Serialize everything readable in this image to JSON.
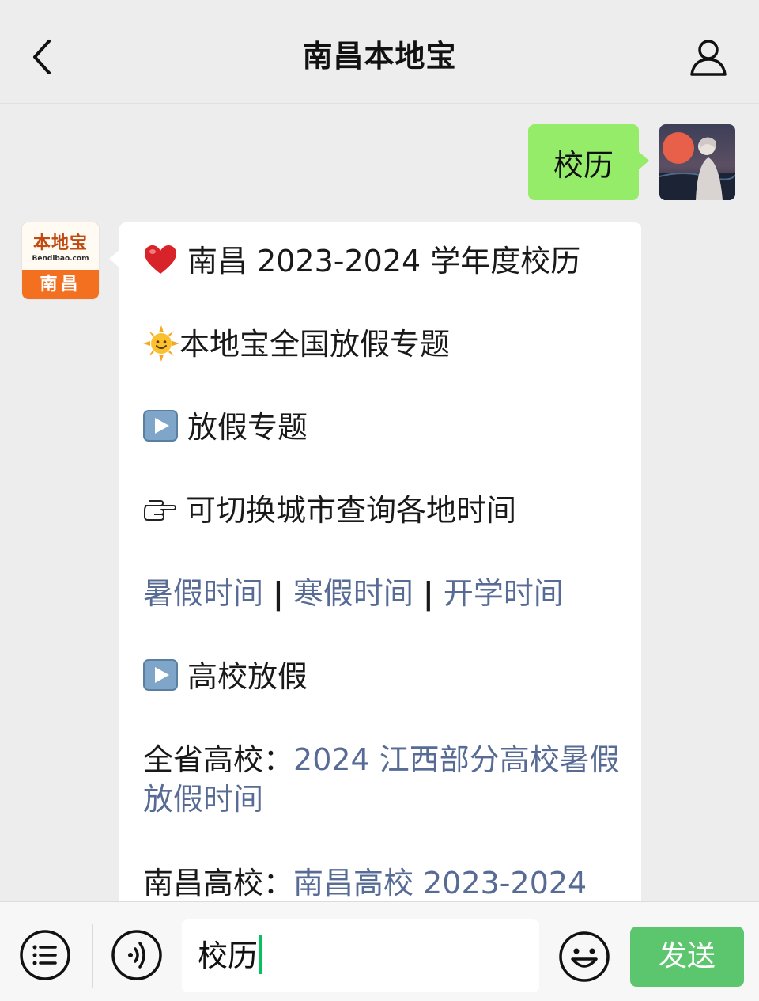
{
  "header": {
    "title": "南昌本地宝",
    "back_icon": "chevron-left-icon",
    "profile_icon": "person-icon"
  },
  "outgoing": {
    "text": "校历"
  },
  "account": {
    "logo_brand": "本地宝",
    "logo_domain": "Bendibao.com",
    "logo_city": "南昌"
  },
  "message": {
    "line1": {
      "icon": "heart-icon",
      "text": "南昌 2023-2024 学年度校历"
    },
    "line2": {
      "icon": "sun-icon",
      "text": "本地宝全国放假专题"
    },
    "line3": {
      "icon": "play-button-icon",
      "text": "放假专题"
    },
    "line4": {
      "icon": "pointing-hand-icon",
      "text": "可切换城市查询各地时间"
    },
    "links": {
      "summer": "暑假时间",
      "winter": "寒假时间",
      "school_start": "开学时间",
      "separator": "|"
    },
    "line6": {
      "icon": "play-button-icon",
      "text": "高校放假"
    },
    "line7": {
      "label": "全省高校：",
      "link": "2024 江西部分高校暑假放假时间"
    },
    "line8": {
      "label": "南昌高校：",
      "link": "南昌高校 2023-2024"
    }
  },
  "inputbar": {
    "menu_icon": "list-icon",
    "voice_icon": "voice-icon",
    "input_value": "校历",
    "emoji_icon": "smiley-icon",
    "send_label": "发送"
  },
  "colors": {
    "background": "#ededed",
    "outgoing_bubble": "#95ec69",
    "link": "#576b95",
    "send_button": "#5cc66e",
    "brand_orange": "#f37021"
  }
}
